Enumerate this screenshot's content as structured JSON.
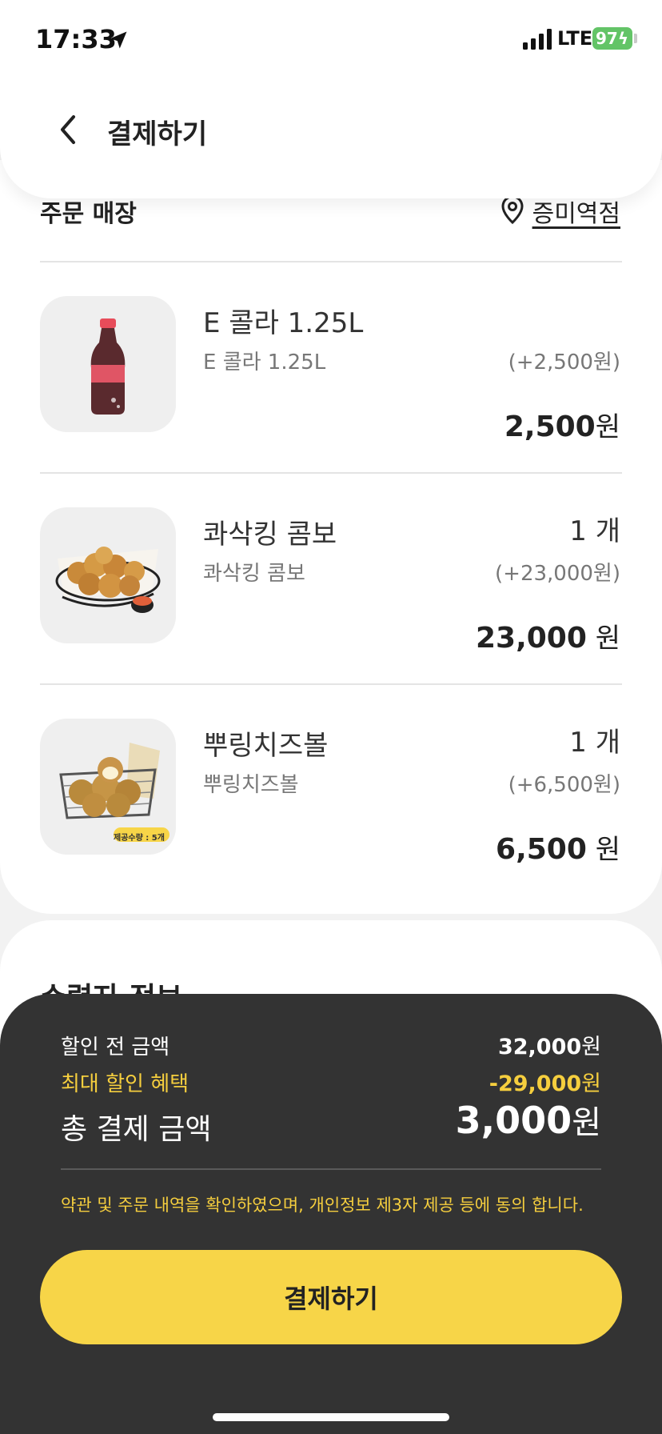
{
  "status_bar": {
    "time": "17:33",
    "network": "LTE",
    "battery": "97"
  },
  "header": {
    "title": "결제하기"
  },
  "store": {
    "label": "주문 매장",
    "name": "증미역점"
  },
  "items": [
    {
      "name": "E 콜라 1.25L",
      "sub": "E 콜라 1.25L",
      "qty": "",
      "add": "(+2,500원)",
      "price": "2,500",
      "unit": "원",
      "thumb_icon": "cola-bottle-icon"
    },
    {
      "name": "콰삭킹 콤보",
      "sub": "콰삭킹 콤보",
      "qty": "1 개",
      "add": "(+23,000원)",
      "price": "23,000",
      "unit": " 원",
      "thumb_icon": "fried-chicken-basket-icon"
    },
    {
      "name": "뿌링치즈볼",
      "sub": "뿌링치즈볼",
      "qty": "1 개",
      "add": "(+6,500원)",
      "price": "6,500",
      "unit": " 원",
      "thumb_icon": "cheese-ball-basket-icon",
      "badge": "제공수량 : 5개"
    }
  ],
  "next_section": {
    "title": "수령자 정보"
  },
  "summary": {
    "before_discount_label": "할인 전 금액",
    "before_discount_value": "32,000",
    "discount_label": "최대 할인 혜택",
    "discount_value": "-29,000",
    "total_label": "총 결제 금액",
    "total_value": "3,000",
    "currency": "원",
    "agreement": "약관 및 주문 내역을 확인하였으며, 개인정보 제3자 제공 등에 동의 합니다.",
    "pay_button": "결제하기"
  },
  "colors": {
    "accent": "#f7d548",
    "panel": "#333333",
    "discount": "#f5ce3e"
  }
}
